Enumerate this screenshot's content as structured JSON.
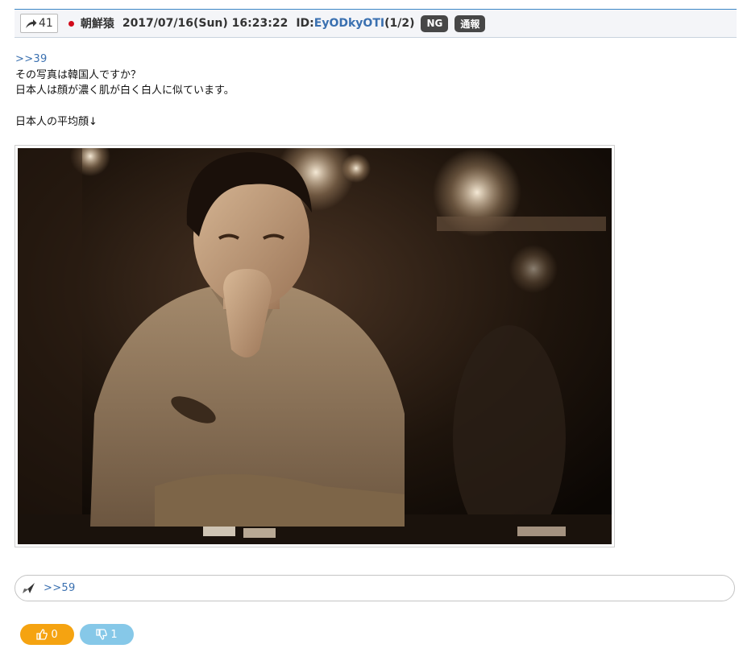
{
  "post": {
    "number": "41",
    "author": "朝鮮猿",
    "datetime": "2017/07/16(Sun) 16:23:22",
    "id_label": "ID:",
    "id_value": "EyODkyOTI",
    "id_count": "(1/2)",
    "ng_label": "NG",
    "report_label": "通報",
    "reply_anchor": ">>39",
    "lines": [
      "その写真は韓国人ですか？",
      "日本人は顔が濃く肌が白く白人に似ています。",
      "",
      "日本人の平均顔↓"
    ]
  },
  "replies": {
    "icon": "reply-arrow-icon",
    "anchor": ">>59"
  },
  "votes": {
    "good_count": "0",
    "bad_count": "1",
    "good_icon": "thumbs-up-icon",
    "bad_icon": "thumbs-down-icon"
  },
  "colors": {
    "header_border": "#3b86c6",
    "header_bg": "#f4f5f8",
    "link": "#3a70b0",
    "badge": "#474747",
    "good": "#f5a311",
    "bad": "#86c8e8"
  }
}
